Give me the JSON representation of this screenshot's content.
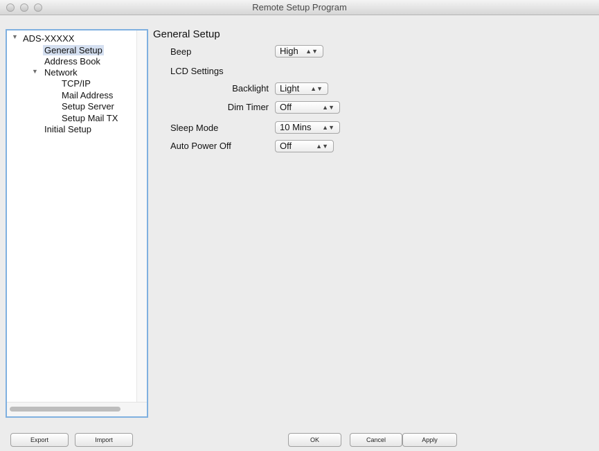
{
  "window": {
    "title": "Remote Setup Program"
  },
  "sidebar": {
    "items": [
      {
        "label": "ADS-XXXXX",
        "expanded": true
      },
      {
        "label": "General Setup",
        "selected": true
      },
      {
        "label": "Address Book"
      },
      {
        "label": "Network",
        "expanded": true
      },
      {
        "label": "TCP/IP"
      },
      {
        "label": "Mail Address"
      },
      {
        "label": "Setup Server"
      },
      {
        "label": "Setup Mail TX"
      },
      {
        "label": "Initial Setup"
      }
    ]
  },
  "main": {
    "section_title": "General Setup",
    "beep": {
      "label": "Beep",
      "value": "High"
    },
    "lcd": {
      "label": "LCD Settings",
      "backlight": {
        "label": "Backlight",
        "value": "Light"
      },
      "dim_timer": {
        "label": "Dim Timer",
        "value": "Off"
      }
    },
    "sleep_mode": {
      "label": "Sleep Mode",
      "value": "10 Mins"
    },
    "auto_power_off": {
      "label": "Auto Power Off",
      "value": "Off"
    }
  },
  "buttons": {
    "export": "Export",
    "import": "Import",
    "ok": "OK",
    "cancel": "Cancel",
    "apply": "Apply"
  },
  "icons": {
    "disclosure": "disclosure-triangle-icon",
    "popup_arrows": "up-down-arrows-icon"
  }
}
